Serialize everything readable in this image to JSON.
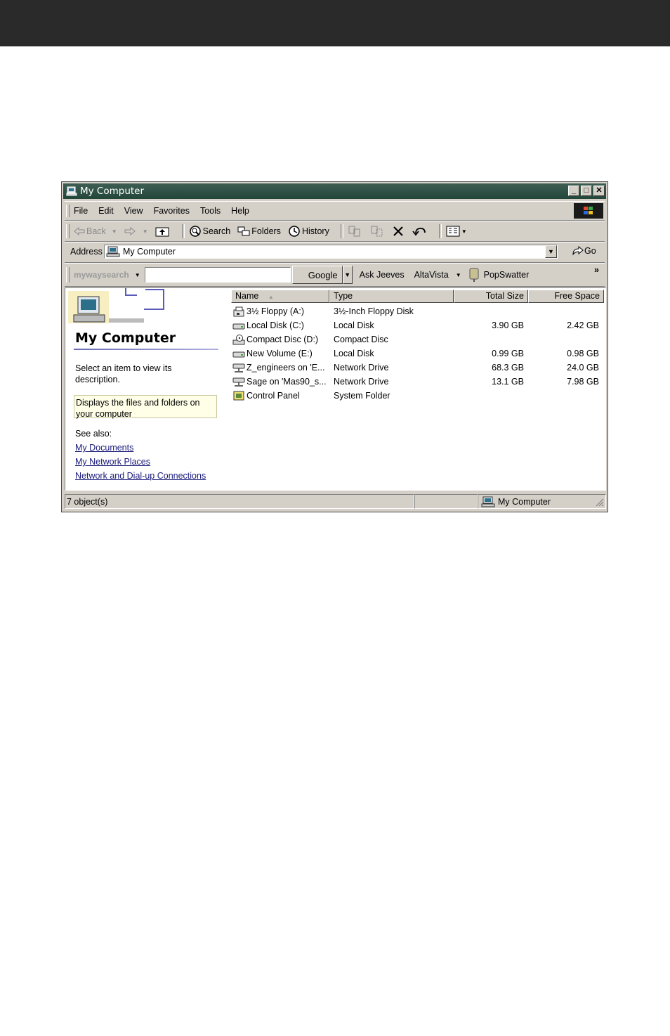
{
  "window": {
    "title": "My Computer",
    "min_symbol": "_",
    "max_symbol": "□",
    "close_symbol": "✕"
  },
  "menu": [
    "File",
    "Edit",
    "View",
    "Favorites",
    "Tools",
    "Help"
  ],
  "toolbar": {
    "back": "Back",
    "search": "Search",
    "folders": "Folders",
    "history": "History"
  },
  "address": {
    "label": "Address",
    "value": "My Computer",
    "go": "Go"
  },
  "searchbar": {
    "brand": "mywaysearch",
    "input_value": "",
    "google": "Google",
    "ask_jeeves": "Ask Jeeves",
    "altavista": "AltaVista",
    "popswatter": "PopSwatter",
    "more": "»"
  },
  "left_pane": {
    "title": "My Computer",
    "hint": "Select an item to view its description.",
    "description": "Displays the files and folders on your computer",
    "see_also": "See also:",
    "links": [
      "My Documents",
      "My Network Places",
      "Network and Dial-up Connections"
    ]
  },
  "columns": {
    "name": "Name",
    "sort_indicator": "▲",
    "type": "Type",
    "total": "Total Size",
    "free": "Free Space"
  },
  "items": [
    {
      "name": "3½ Floppy (A:)",
      "type": "3½-Inch Floppy Disk",
      "total": "",
      "free": "",
      "icon": "floppy-icon"
    },
    {
      "name": "Local Disk (C:)",
      "type": "Local Disk",
      "total": "3.90 GB",
      "free": "2.42 GB",
      "icon": "hard-drive-icon"
    },
    {
      "name": "Compact Disc (D:)",
      "type": "Compact Disc",
      "total": "",
      "free": "",
      "icon": "cd-drive-icon"
    },
    {
      "name": "New Volume (E:)",
      "type": "Local Disk",
      "total": "0.99 GB",
      "free": "0.98 GB",
      "icon": "hard-drive-icon"
    },
    {
      "name": "Z_engineers on 'E...",
      "type": "Network Drive",
      "total": "68.3 GB",
      "free": "24.0 GB",
      "icon": "network-drive-icon"
    },
    {
      "name": "Sage on 'Mas90_s...",
      "type": "Network Drive",
      "total": "13.1 GB",
      "free": "7.98 GB",
      "icon": "network-drive-icon"
    },
    {
      "name": "Control Panel",
      "type": "System Folder",
      "total": "",
      "free": "",
      "icon": "control-panel-icon"
    }
  ],
  "status": {
    "count": "7 object(s)",
    "zone": "My Computer"
  }
}
